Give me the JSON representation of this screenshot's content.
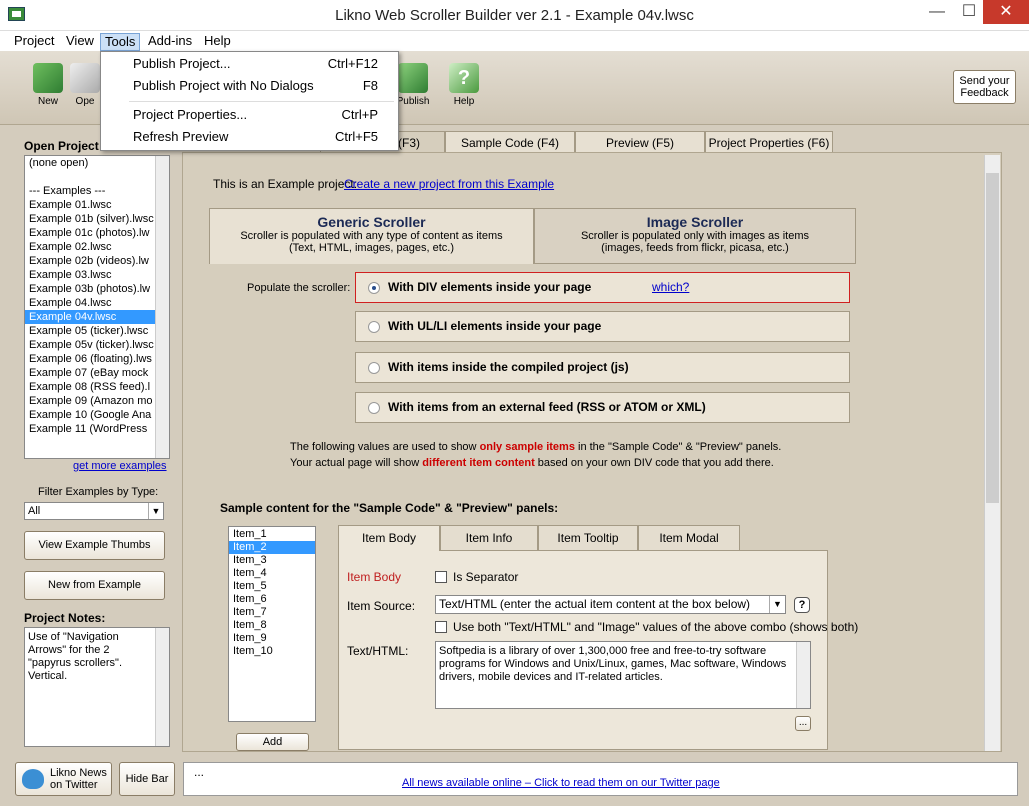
{
  "window": {
    "title": "Likno Web Scroller Builder ver 2.1 - Example 04v.lwsc",
    "minimize": "—",
    "maximize": "☐",
    "close": "✕"
  },
  "menu": [
    "Project",
    "View",
    "Tools",
    "Add-ins",
    "Help"
  ],
  "toolbar": {
    "new": "New",
    "open": "Ope",
    "publish": "Publish",
    "help": "Help",
    "feedback": "Send your Feedback"
  },
  "dropdown": [
    {
      "label": "Publish Project...",
      "shortcut": "Ctrl+F12"
    },
    {
      "label": "Publish Project with No Dialogs",
      "shortcut": "F8"
    },
    {
      "label": "Project Properties...",
      "shortcut": "Ctrl+P"
    },
    {
      "label": "Refresh Preview",
      "shortcut": "Ctrl+F5"
    }
  ],
  "left": {
    "open_title": "Open Project",
    "projects": [
      "(none open)",
      "",
      "--- Examples ---",
      "Example 01.lwsc",
      "Example 01b (silver).lwsc",
      "Example 01c (photos).lw",
      "Example 02.lwsc",
      "Example 02b (videos).lw",
      "Example 03.lwsc",
      "Example 03b (photos).lw",
      "Example 04.lwsc",
      "Example 04v.lwsc",
      "Example 05 (ticker).lwsc",
      "Example 05v (ticker).lwsc",
      "Example 06 (floating).lws",
      "Example 07 (eBay mock",
      "Example 08 (RSS feed).l",
      "Example 09 (Amazon mo",
      "Example 10 (Google Ana",
      "Example 11 (WordPress"
    ],
    "more_link": "get more examples",
    "filter_label": "Filter Examples by Type:",
    "filter_value": "All",
    "thumbs_btn": "View Example Thumbs",
    "new_btn": "New from Example",
    "notes_title": "Project Notes:",
    "notes": "Use of \"Navigation Arrows\" for the 2 \"papyrus scrollers\". Vertical."
  },
  "tabs": [
    "(F3)",
    "Sample Code  (F4)",
    "Preview   (F5)",
    "Project Properties  (F6)"
  ],
  "main": {
    "intro": "This is an Example project:",
    "intro_link": "Create a new project from this Example",
    "generic_title": "Generic Scroller",
    "generic_desc": "Scroller is populated with any type of content as items (Text, HTML, images, pages, etc.)",
    "image_title": "Image Scroller",
    "image_desc": "Scroller is populated only with images as items (images, feeds from flickr, picasa, etc.)",
    "populate_label": "Populate the scroller:",
    "options": [
      "With DIV elements inside your page",
      "With UL/LI elements inside your page",
      "With items inside the compiled project (js)",
      "With items from an external feed (RSS or ATOM or XML)"
    ],
    "which": "which?",
    "note1a": "The following values are used to show ",
    "note1b": "only sample items",
    "note1c": " in the \"Sample Code\" & \"Preview\" panels.",
    "note2a": "Your actual page will show ",
    "note2b": "different item content",
    "note2c": " based on your own DIV code that you add there.",
    "sample_title": "Sample content for the \"Sample Code\" & \"Preview\" panels:",
    "items": [
      "Item_1",
      "Item_2",
      "Item_3",
      "Item_4",
      "Item_5",
      "Item_6",
      "Item_7",
      "Item_8",
      "Item_9",
      "Item_10"
    ],
    "add_btn": "Add",
    "subtabs": [
      "Item Body",
      "Item Info",
      "Item Tooltip",
      "Item Modal"
    ],
    "item_body_label": "Item Body",
    "is_separator": "Is Separator",
    "source_label": "Item Source:",
    "source_value": "Text/HTML (enter the actual item content at the box below)",
    "use_both": "Use both \"Text/HTML\" and \"Image\" values of the above combo (shows both)",
    "texthtml_label": "Text/HTML:",
    "texthtml_value": "Softpedia is a library of over 1,300,000 free and free-to-try software programs for Windows and Unix/Linux, games, Mac software, Windows drivers, mobile devices and IT-related articles.",
    "more_btn": "..."
  },
  "status": {
    "news_btn": "Likno News on Twitter",
    "hidebar_btn": "Hide Bar",
    "ellipsis": "...",
    "news_link": "All news available online – Click to read them on our Twitter page"
  }
}
